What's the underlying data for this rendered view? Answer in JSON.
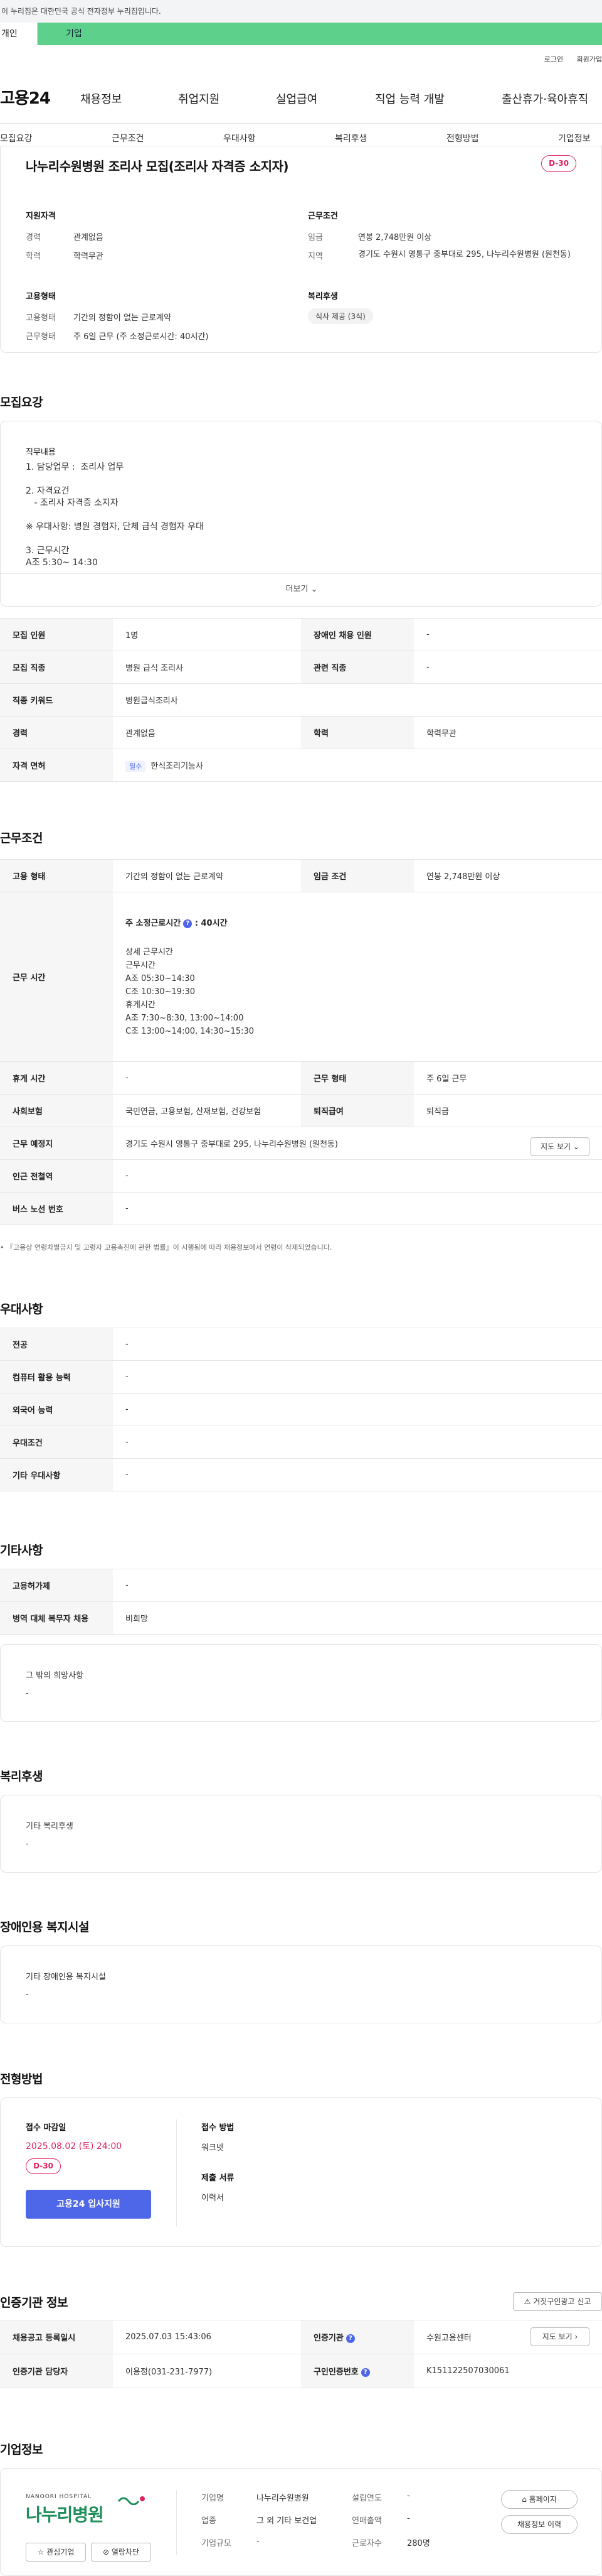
{
  "gov_bar": {
    "text": "이 누리집은 대한민국 공식 전자정부 누리집입니다."
  },
  "user_tabs": {
    "personal": "개인",
    "enterprise": "기업"
  },
  "util_links": {
    "login": "로그인",
    "join": "회원가입"
  },
  "gnb": {
    "logo": "고용24",
    "menu": [
      "채용정보",
      "취업지원",
      "실업급여",
      "직업 능력 개발",
      "출산휴가·육아휴직"
    ]
  },
  "subnav": [
    "모집요강",
    "근무조건",
    "우대사항",
    "복리후생",
    "전형방법",
    "기업정보"
  ],
  "summary": {
    "title": "나누리수원병원 조리사 모집(조리사 자격증 소지자)",
    "dday": "D-30",
    "qualification": {
      "heading": "지원자격",
      "career_label": "경력",
      "career": "관계없음",
      "edu_label": "학력",
      "edu": "학력무관"
    },
    "conditions": {
      "heading": "근무조건",
      "wage_label": "임금",
      "wage": "연봉 2,748만원 이상",
      "location_label": "지역",
      "location": "경기도 수원시 영통구 중부대로 295, 나누리수원병원 (원천동)"
    },
    "employment": {
      "heading": "고용형태",
      "type_label": "고용형태",
      "type": "기간의 정함이 없는 근로계약",
      "form_label": "근무형태",
      "form": "주 6일 근무 (주 소정근로시간: 40시간)"
    },
    "welfare": {
      "heading": "복리후생",
      "chip": "식사 제공 (3식)"
    }
  },
  "recruit": {
    "section_title": "모집요강",
    "duty_label": "직무내용",
    "description": "1. 담당업무 :  조리사 업무\n\n2. 자격요건\n   - 조리사 자격증 소지자\n\n※ 우대사항: 병원 경험자, 단체 급식 경험자 우대\n\n3. 근무시간\nA조 5:30~ 14:30",
    "more": "더보기",
    "table": {
      "headcount_label": "모집 인원",
      "headcount": "1명",
      "disabled_label": "장애인 채용 인원",
      "disabled": "-",
      "job_label": "모집 직종",
      "job": "병원 급식 조리사",
      "related_label": "관련 직종",
      "related": "-",
      "keyword_label": "직종 키워드",
      "keyword": "병원급식조리사",
      "career_label": "경력",
      "career": "관계없음",
      "edu_label": "학력",
      "edu": "학력무관",
      "license_label": "자격 면허",
      "license_badge": "필수",
      "license": "한식조리기능사"
    }
  },
  "work": {
    "section_title": "근무조건",
    "type_label": "고용 형태",
    "type": "기간의 정함이 없는 근로계약",
    "wage_label": "임금 조건",
    "wage": "연봉 2,748만원 이상",
    "hours_label": "근무 시간",
    "hours_weekly_label": "주 소정근로시간",
    "hours_weekly": "40시간",
    "hours_detail_title": "상세 근무시간",
    "hours_detail": "근무시간\nA조 05:30~14:30\nC조 10:30~19:30\n휴게시간\nA조 7:30~8:30, 13:00~14:00\nC조 13:00~14:00, 14:30~15:30",
    "break_label": "휴게 시간",
    "break": "-",
    "form_label": "근무 형태",
    "form": "주 6일 근무",
    "insurance_label": "사회보험",
    "insurance": "국민연금, 고용보험, 산재보험, 건강보험",
    "severance_label": "퇴직급여",
    "severance": "퇴직금",
    "place_label": "근무 예정지",
    "place": "경기도 수원시 영통구 중부대로 295, 나누리수원병원 (원천동)",
    "map_btn": "지도 보기",
    "subway_label": "인근 전철역",
    "subway": "-",
    "bus_label": "버스 노선 번호",
    "bus": "-",
    "note": "『고용상 연령차별금지 및 고령자 고용촉진에 관한 법률』이 시행됨에 따라 채용정보에서 연령이 삭제되었습니다."
  },
  "preferred": {
    "section_title": "우대사항",
    "rows": [
      {
        "label": "전공",
        "value": "-"
      },
      {
        "label": "컴퓨터 활용 능력",
        "value": "-"
      },
      {
        "label": "외국어 능력",
        "value": "-"
      },
      {
        "label": "우대조건",
        "value": "-"
      },
      {
        "label": "기타 우대사항",
        "value": "-"
      }
    ]
  },
  "etc": {
    "section_title": "기타사항",
    "rows": [
      {
        "label": "고용허가제",
        "value": "-"
      },
      {
        "label": "병역 대체 복무자 채용",
        "value": "비희망"
      }
    ],
    "other_title": "그 밖의 희망사항",
    "other_value": "-"
  },
  "welfare_section": {
    "section_title": "복리후생",
    "card_title": "기타 복리후생",
    "card_value": "-"
  },
  "disability_section": {
    "section_title": "장애인용 복지시설",
    "card_title": "기타 장애인용 복지시설",
    "card_value": "-"
  },
  "selection": {
    "section_title": "전형방법",
    "deadline_label": "접수 마감일",
    "deadline": "2025.08.02 (토) 24:00",
    "dday": "D-30",
    "apply_btn": "고용24 입사지원",
    "method_label": "접수 방법",
    "method": "워크넷",
    "docs_label": "제출 서류",
    "docs": "이력서"
  },
  "agency": {
    "section_title": "인증기관 정보",
    "report_btn": "거짓구인광고 신고",
    "reg_date_label": "채용공고 등록일시",
    "reg_date": "2025.07.03 15:43:06",
    "agency_label": "인증기관",
    "agency": "수원고용센터",
    "map_btn": "지도 보기",
    "manager_label": "인증기관 담당자",
    "manager": "이용정(031-231-7977)",
    "notice_no_label": "구인인증번호",
    "notice_no": "K151122507030061"
  },
  "company": {
    "section_title": "기업정보",
    "logo_sub": "NANOORI HOSPITAL",
    "logo_main": "나누리병원",
    "interest_btn": "관심기업",
    "block_btn": "열람차단",
    "name_label": "기업명",
    "name": "나누리수원병원",
    "industry_label": "업종",
    "industry": "그 외 기타 보건업",
    "size_label": "기업규모",
    "size": "-",
    "founded_label": "설립연도",
    "founded": "-",
    "revenue_label": "연매출액",
    "revenue": "-",
    "employees_label": "근로자수",
    "employees": "280명",
    "homepage_btn": "홈페이지",
    "other_jobs_btn": "채용정보 이력"
  }
}
